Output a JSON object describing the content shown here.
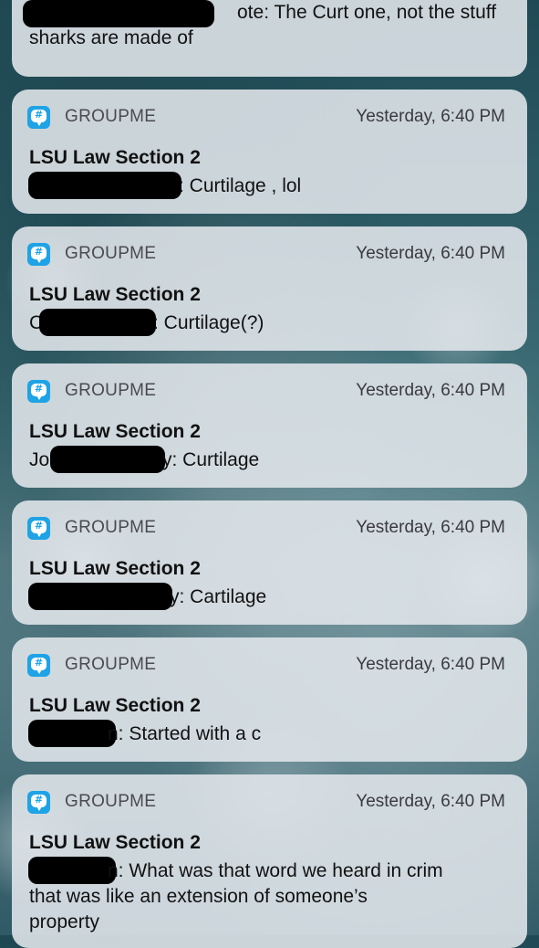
{
  "partial_notification": {
    "message_visible": "ote: The Curt one, not the stuff",
    "message_line2": "sharks are made of"
  },
  "notifications": [
    {
      "app": "GROUPME",
      "icon": "groupme-icon",
      "time": "Yesterday, 6:40 PM",
      "title": "LSU Law Section 2",
      "sender_visible": "",
      "message": ": Curtilage , lol"
    },
    {
      "app": "GROUPME",
      "icon": "groupme-icon",
      "time": "Yesterday, 6:40 PM",
      "title": "LSU Law Section 2",
      "sender_visible": "C",
      "message": ": Curtilage(?)"
    },
    {
      "app": "GROUPME",
      "icon": "groupme-icon",
      "time": "Yesterday, 6:40 PM",
      "title": "LSU Law Section 2",
      "sender_visible": "Jo",
      "message": "y: Curtilage"
    },
    {
      "app": "GROUPME",
      "icon": "groupme-icon",
      "time": "Yesterday, 6:40 PM",
      "title": "LSU Law Section 2",
      "sender_visible": "",
      "message": "y: Cartilage"
    },
    {
      "app": "GROUPME",
      "icon": "groupme-icon",
      "time": "Yesterday, 6:40 PM",
      "title": "LSU Law Section 2",
      "sender_visible": "",
      "message": "n: Started with a c"
    },
    {
      "app": "GROUPME",
      "icon": "groupme-icon",
      "time": "Yesterday, 6:40 PM",
      "title": "LSU Law Section 2",
      "sender_visible": "",
      "message": "n: What was that word we heard in crim",
      "message_line2": "that was like an extension of someone’s",
      "message_line3": "property"
    }
  ],
  "colors": {
    "groupme_blue": "#1ea3e6",
    "card_background": "#e2e7ec"
  }
}
